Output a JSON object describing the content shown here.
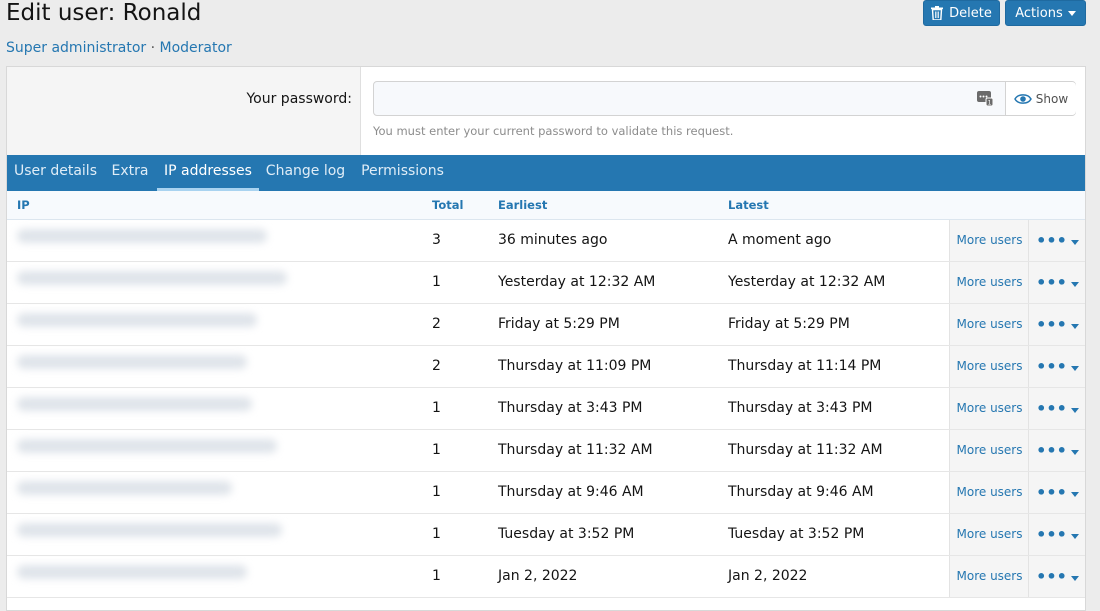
{
  "header": {
    "title": "Edit user: Ronald",
    "groups": [
      "Super administrator",
      "Moderator"
    ],
    "group_separator": "·",
    "delete_label": "Delete",
    "actions_label": "Actions"
  },
  "password": {
    "label": "Your password:",
    "value": "",
    "show_label": "Show",
    "hint": "You must enter your current password to validate this request."
  },
  "tabs": [
    {
      "label": "User details",
      "active": false
    },
    {
      "label": "Extra",
      "active": false
    },
    {
      "label": "IP addresses",
      "active": true
    },
    {
      "label": "Change log",
      "active": false
    },
    {
      "label": "Permissions",
      "active": false
    }
  ],
  "table": {
    "columns": {
      "ip": "IP",
      "total": "Total",
      "earliest": "Earliest",
      "latest": "Latest"
    },
    "more_users_label": "More users",
    "rows": [
      {
        "total": "3",
        "earliest": "36 minutes ago",
        "latest": "A moment ago"
      },
      {
        "total": "1",
        "earliest": "Yesterday at 12:32 AM",
        "latest": "Yesterday at 12:32 AM"
      },
      {
        "total": "2",
        "earliest": "Friday at 5:29 PM",
        "latest": "Friday at 5:29 PM"
      },
      {
        "total": "2",
        "earliest": "Thursday at 11:09 PM",
        "latest": "Thursday at 11:14 PM"
      },
      {
        "total": "1",
        "earliest": "Thursday at 3:43 PM",
        "latest": "Thursday at 3:43 PM"
      },
      {
        "total": "1",
        "earliest": "Thursday at 11:32 AM",
        "latest": "Thursday at 11:32 AM"
      },
      {
        "total": "1",
        "earliest": "Thursday at 9:46 AM",
        "latest": "Thursday at 9:46 AM"
      },
      {
        "total": "1",
        "earliest": "Tuesday at 3:52 PM",
        "latest": "Tuesday at 3:52 PM"
      },
      {
        "total": "1",
        "earliest": "Jan 2, 2022",
        "latest": "Jan 2, 2022"
      }
    ]
  },
  "colors": {
    "accent": "#2577b1",
    "tab_active_underline": "#a9d3f0"
  },
  "icons": {
    "delete": "trash-icon",
    "password_manager": "key-icon",
    "show": "eye-icon",
    "row_menu": "more-dots-icon"
  }
}
